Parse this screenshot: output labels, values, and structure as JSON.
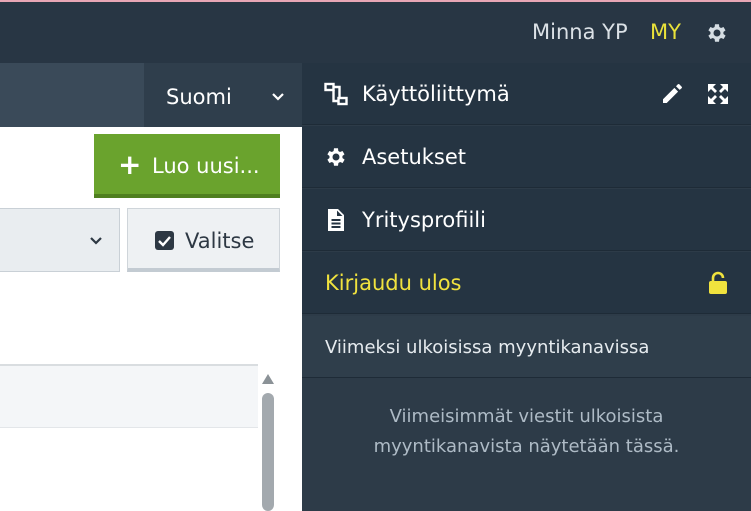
{
  "header": {
    "user_name": "Minna YP",
    "user_initials": "MY",
    "settings_icon": "gear-icon"
  },
  "background_app": {
    "language": "Suomi",
    "create_button_label": "Luo uusi...",
    "select_button_label": "Valitse"
  },
  "menu": {
    "items": [
      {
        "label": "Käyttöliittymä",
        "icon": "interface-icon",
        "actions": [
          "edit-icon",
          "expand-icon"
        ]
      },
      {
        "label": "Asetukset",
        "icon": "gear-icon"
      },
      {
        "label": "Yritysprofiili",
        "icon": "document-icon"
      },
      {
        "label": "Kirjaudu ulos",
        "icon": "unlock-icon"
      }
    ],
    "external_channels": {
      "title": "Viimeksi ulkoisissa myyntikanavissa",
      "empty_message_line1": "Viimeisimmät viestit ulkoisista",
      "empty_message_line2": "myyntikanavista näytetään tässä."
    }
  },
  "colors": {
    "topbar": "#283644",
    "menu_bg": "#2d3b48",
    "accent_yellow": "#e9e23a",
    "create_green": "#6aa32d"
  }
}
